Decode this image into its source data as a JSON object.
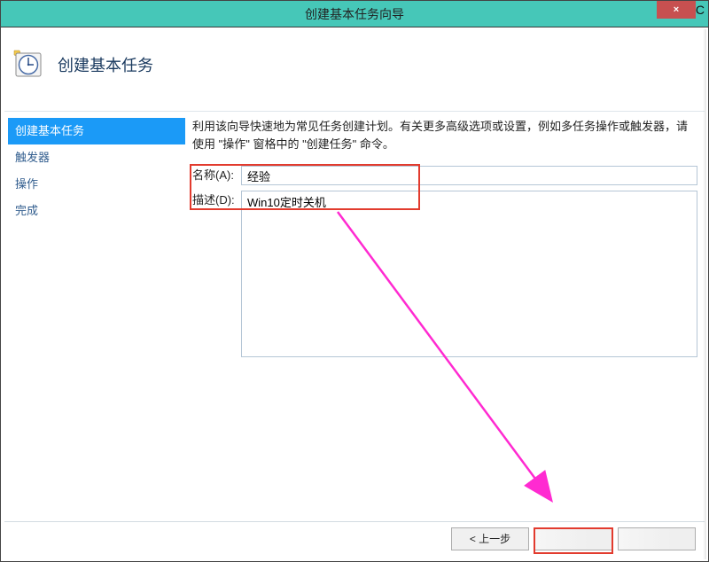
{
  "window": {
    "title": "创建基本任务向导",
    "subtitle": "创建基本任务"
  },
  "steps": {
    "create": "创建基本任务",
    "trigger": "触发器",
    "action": "操作",
    "finish": "完成",
    "active": "create"
  },
  "content": {
    "intro": "利用该向导快速地为常见任务创建计划。有关更多高级选项或设置，例如多任务操作或触发器，请使用 \"操作\" 窗格中的 \"创建任务\" 命令。",
    "name_label": "名称(A):",
    "name_value": "经验",
    "desc_label": "描述(D):",
    "desc_value": "Win10定时关机"
  },
  "buttons": {
    "back": "< 上一步",
    "next": "",
    "cancel": ""
  },
  "close_label": "×"
}
